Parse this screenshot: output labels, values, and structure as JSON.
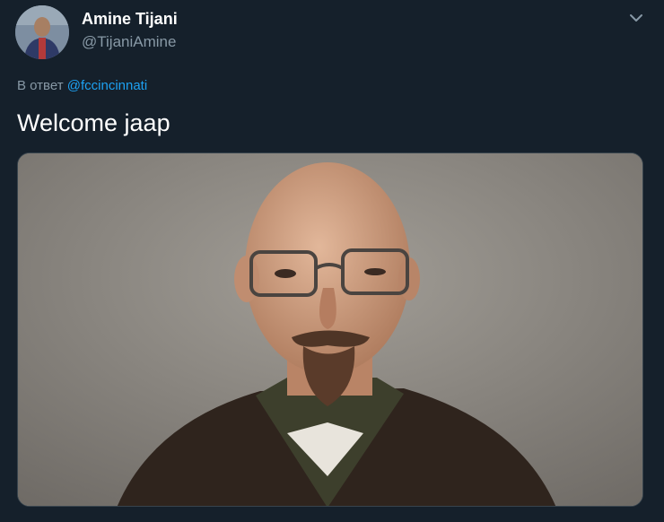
{
  "author": {
    "display_name": "Amine Tijani",
    "handle": "@TijaniAmine"
  },
  "reply_context": {
    "prefix": "В ответ",
    "mention": "@fccincinnati"
  },
  "tweet": {
    "text": "Welcome jaap"
  },
  "icons": {
    "menu": "chevron-down-icon"
  },
  "colors": {
    "background": "#15202b",
    "secondary_text": "#8899a6",
    "link": "#1da1f2",
    "primary_text": "#ffffff"
  }
}
